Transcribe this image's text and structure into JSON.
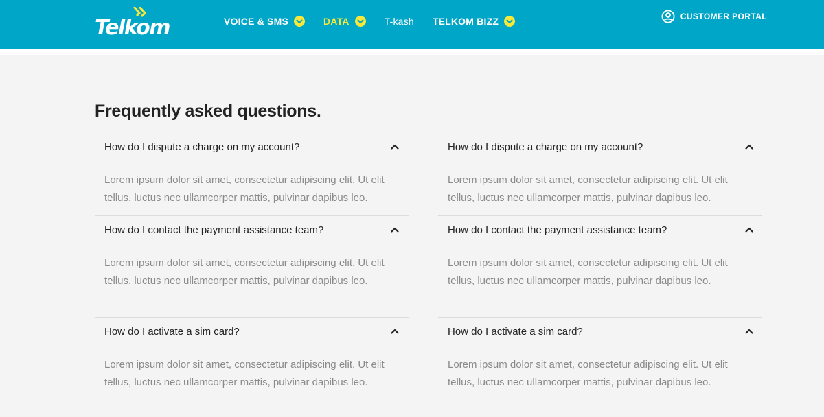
{
  "header": {
    "logo_text": "Telkom",
    "colors": {
      "bar": "#00a6c7",
      "nav_active": "#f7e83a",
      "accent_chevron": "#f7e83a"
    },
    "nav": [
      {
        "label": "VOICE & SMS",
        "has_dropdown": true,
        "active": false
      },
      {
        "label": "DATA",
        "has_dropdown": true,
        "active": true
      },
      {
        "label": "T-kash",
        "has_dropdown": false,
        "active": false
      },
      {
        "label": "TELKOM BIZZ",
        "has_dropdown": true,
        "active": false
      }
    ],
    "portal_label": "CUSTOMER PORTAL",
    "portal_icon": "user-circle-icon"
  },
  "faq": {
    "title": "Frequently asked questions.",
    "left": [
      {
        "question": "How do I dispute a charge on my account?",
        "answer": "Lorem ipsum dolor sit amet, consectetur adipiscing elit. Ut elit\ntellus, luctus nec ullamcorper mattis, pulvinar dapibus leo.",
        "expanded": true
      },
      {
        "question": "How do I contact the payment assistance team?",
        "answer": "Lorem ipsum dolor sit amet, consectetur adipiscing elit. Ut elit\ntellus, luctus nec ullamcorper mattis, pulvinar dapibus leo.",
        "expanded": true
      },
      {
        "question": "How do I activate a sim card?",
        "answer": "Lorem ipsum dolor sit amet, consectetur adipiscing elit. Ut elit\ntellus, luctus nec ullamcorper mattis, pulvinar dapibus leo.",
        "expanded": true
      }
    ],
    "right": [
      {
        "question": "How do I dispute a charge on my account?",
        "answer": "Lorem ipsum dolor sit amet, consectetur adipiscing elit. Ut elit\ntellus, luctus nec ullamcorper mattis, pulvinar dapibus leo.",
        "expanded": true
      },
      {
        "question": "How do I contact the payment assistance team?",
        "answer": "Lorem ipsum dolor sit amet, consectetur adipiscing elit. Ut elit\ntellus, luctus nec ullamcorper mattis, pulvinar dapibus leo.",
        "expanded": true
      },
      {
        "question": "How do I activate a sim card?",
        "answer": "Lorem ipsum dolor sit amet, consectetur adipiscing elit. Ut elit\ntellus, luctus nec ullamcorper mattis, pulvinar dapibus leo.",
        "expanded": true
      }
    ]
  }
}
